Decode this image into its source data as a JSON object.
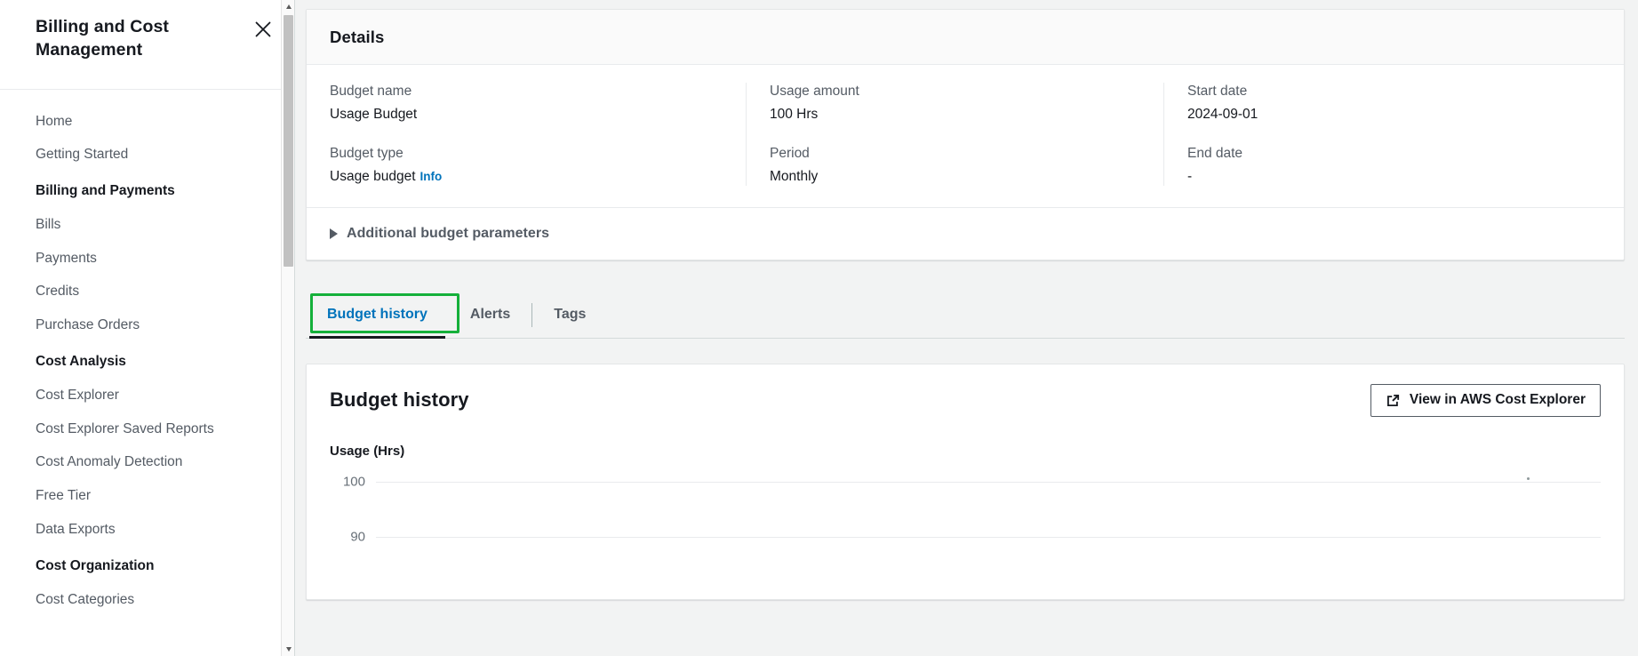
{
  "sidebar": {
    "title": "Billing and Cost Management",
    "close_icon": "close-icon",
    "items": [
      {
        "label": "Home",
        "type": "link"
      },
      {
        "label": "Getting Started",
        "type": "link"
      },
      {
        "label": "Billing and Payments",
        "type": "section"
      },
      {
        "label": "Bills",
        "type": "link"
      },
      {
        "label": "Payments",
        "type": "link"
      },
      {
        "label": "Credits",
        "type": "link"
      },
      {
        "label": "Purchase Orders",
        "type": "link"
      },
      {
        "label": "Cost Analysis",
        "type": "section"
      },
      {
        "label": "Cost Explorer",
        "type": "link"
      },
      {
        "label": "Cost Explorer Saved Reports",
        "type": "link"
      },
      {
        "label": "Cost Anomaly Detection",
        "type": "link"
      },
      {
        "label": "Free Tier",
        "type": "link"
      },
      {
        "label": "Data Exports",
        "type": "link"
      },
      {
        "label": "Cost Organization",
        "type": "section"
      },
      {
        "label": "Cost Categories",
        "type": "link"
      }
    ]
  },
  "details": {
    "heading": "Details",
    "columns": [
      {
        "fields": [
          {
            "label": "Budget name",
            "value": "Usage Budget"
          },
          {
            "label": "Budget type",
            "value": "Usage budget",
            "info": "Info"
          }
        ]
      },
      {
        "fields": [
          {
            "label": "Usage amount",
            "value": "100 Hrs"
          },
          {
            "label": "Period",
            "value": "Monthly"
          }
        ]
      },
      {
        "fields": [
          {
            "label": "Start date",
            "value": "2024-09-01"
          },
          {
            "label": "End date",
            "value": "-"
          }
        ]
      }
    ],
    "expander_label": "Additional budget parameters",
    "expander_icon": "triangle-right-icon"
  },
  "tabs": [
    {
      "label": "Budget history",
      "active": true,
      "highlighted": true
    },
    {
      "label": "Alerts",
      "active": false,
      "highlighted": false
    },
    {
      "label": "Tags",
      "active": false,
      "highlighted": false
    }
  ],
  "budget_history": {
    "heading": "Budget history",
    "view_button_label": "View in AWS Cost Explorer",
    "view_button_icon": "external-link-icon"
  },
  "colors": {
    "accent_link": "#0073bb",
    "highlight_green": "#15b03a",
    "text_primary": "#16191f",
    "text_secondary": "#545b64",
    "page_background": "#f2f3f3"
  },
  "chart_data": {
    "type": "line",
    "title": "Budget history",
    "ylabel": "Usage (Hrs)",
    "xlabel": "",
    "yticks": [
      100,
      90
    ],
    "ylim": [
      90,
      100
    ],
    "grid": true,
    "legend": "none",
    "series": [
      {
        "name": "Usage (Hrs)",
        "x": [],
        "values": []
      }
    ],
    "note": "Only the top of the plot is visible; gridlines at 100 and 90 with a faint marker near the top right."
  }
}
